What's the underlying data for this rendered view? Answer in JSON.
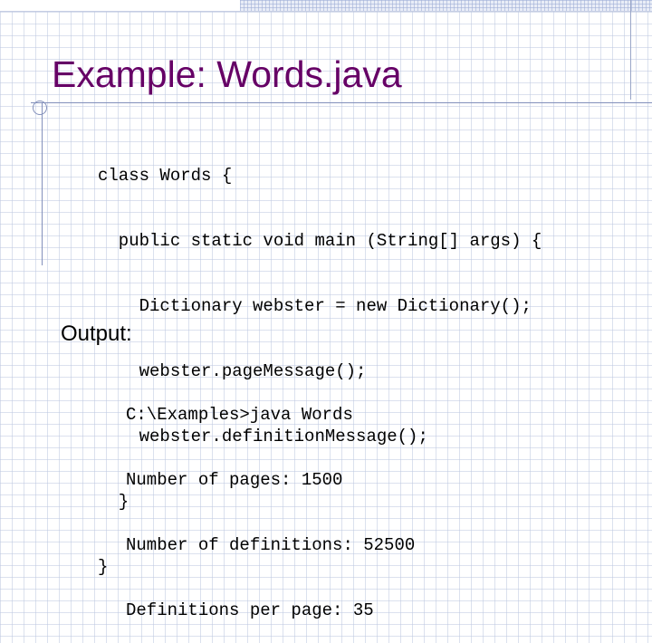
{
  "slide": {
    "title": "Example: Words.java",
    "code_lines": [
      "class Words {",
      "  public static void main (String[] args) {",
      "    Dictionary webster = new Dictionary();",
      "    webster.pageMessage();",
      "    webster.definitionMessage();",
      "  }",
      "}"
    ],
    "output_label": "Output:",
    "output_lines": [
      "C:\\Examples>java Words",
      "Number of pages: 1500",
      "Number of definitions: 52500",
      "Definitions per page: 35"
    ]
  },
  "colors": {
    "title": "#660066",
    "rule": "#8390bb",
    "grid": "#bec8e1"
  }
}
